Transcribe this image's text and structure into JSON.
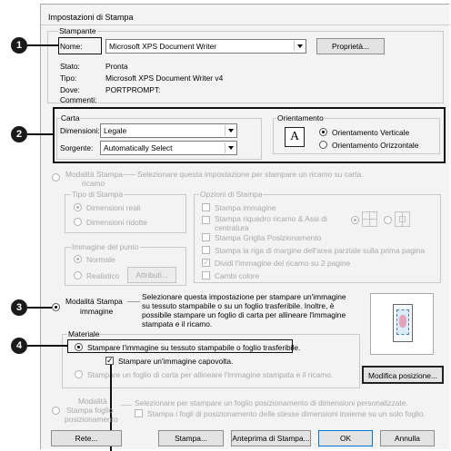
{
  "dialog": {
    "title": "Impostazioni di Stampa"
  },
  "printer": {
    "group_label": "Stampante",
    "name_label": "Nome:",
    "name_value": "Microsoft XPS Document Writer",
    "properties_button": "Proprietà...",
    "status_label": "Stato:",
    "status_value": "Pronta",
    "type_label": "Tipo:",
    "type_value": "Microsoft XPS Document Writer v4",
    "where_label": "Dove:",
    "where_value": "PORTPROMPT:",
    "comment_label": "Commenti:"
  },
  "paper": {
    "group_label": "Carta",
    "size_label": "Dimensioni:",
    "size_value": "Legale",
    "source_label": "Sorgente:",
    "source_value": "Automatically Select"
  },
  "orientation": {
    "group_label": "Orientamento",
    "icon_letter": "A",
    "portrait": "Orientamento Verticale",
    "landscape": "Orientamento Orizzontale"
  },
  "embroidery_mode": {
    "radio_label_line1": "Modalità Stampa",
    "radio_label_line2": "ricamo",
    "description": "Selezionare questa impostazione per stampare un ricamo su carta.",
    "print_type": {
      "group_label": "Tipo di Stampa",
      "actual_size": "Dimensioni reali",
      "reduced_size": "Dimensioni ridotte"
    },
    "point_image": {
      "group_label": "Immagine del punto",
      "normal": "Normale",
      "realistic": "Realistico",
      "attributes_button": "Attributi..."
    },
    "print_options": {
      "group_label": "Opzioni di Stampa",
      "print_image": "Stampa immagine",
      "print_frame_line1": "Stampa riquadro ricamo & Assi di",
      "print_frame_line2": "centratura",
      "print_grid": "Stampa Griglia Posizionamento",
      "print_margin_line": "Stampa la riga di margine dell'area parziale sulla prima pagina",
      "split_image": "Dividi l'immagine del ricamo su 2 pagine",
      "color_changes": "Cambi colore"
    }
  },
  "image_mode": {
    "radio_label_line1": "Modalità Stampa",
    "radio_label_line2": "immagine",
    "description_lines": [
      "Selezionare questa impostazione per stampare un'immagine",
      "su tessuto stampabile o su un foglio trasferibile. Inoltre, è",
      "possibile stampare un foglio di carta per allineare l'immagine",
      "stampata e il ricamo."
    ],
    "material_label": "Materiale",
    "print_on_fabric": "Stampare l'immagine su tessuto stampabile o foglio trasferibile.",
    "mirror_image": "Stampare un'immagine capovolta.",
    "print_alignment_sheet": "Stampare un foglio di carta per allineare l'immagine stampata e il ricamo.",
    "modify_position_button": "Modifica posizione..."
  },
  "positioning_mode": {
    "radio_label_line1": "Modalità",
    "radio_label_line2": "Stampa foglio",
    "radio_label_line3": "posizionamento",
    "description": "Selezionare per stampare un foglio posizionamento di dimensioni personalizzate.",
    "same_size_check": "Stampa i fogli di posizionamento delle stesse dimensioni insieme su un solo foglio."
  },
  "buttons": {
    "network": "Rete...",
    "print": "Stampa...",
    "preview": "Anteprima di Stampa...",
    "ok": "OK",
    "cancel": "Annulla"
  },
  "callouts": [
    "1",
    "2",
    "3",
    "4"
  ]
}
